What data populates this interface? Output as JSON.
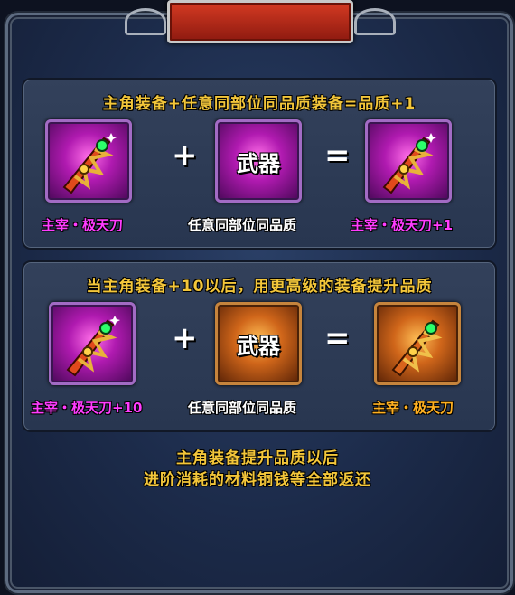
{
  "panel1": {
    "heading": "主角装备+任意同部位同品质装备=品质+1",
    "source_item_name": "主宰・极天刀",
    "material_label": "任意同部位同品质",
    "material_icon_text": "武器",
    "result_item_name": "主宰・极天刀+1",
    "plus_symbol": "+",
    "equals_symbol": "="
  },
  "panel2": {
    "heading": "当主角装备+10以后，用更高级的装备提升品质",
    "source_item_name": "主宰・极天刀+10",
    "material_label": "任意同部位同品质",
    "material_icon_text": "武器",
    "result_item_name": "主宰・极天刀",
    "plus_symbol": "+",
    "equals_symbol": "="
  },
  "footer": {
    "line1": "主角装备提升品质以后",
    "line2": "进阶消耗的材料铜钱等全部返还"
  },
  "colors": {
    "heading": "#f3c63a",
    "purple_item": "#ff3cff",
    "orange_item": "#ffb020",
    "title_bar": "#d43a22"
  },
  "icons": {
    "sword": "sword-icon",
    "weapon_slot": "weapon-placeholder-icon"
  }
}
